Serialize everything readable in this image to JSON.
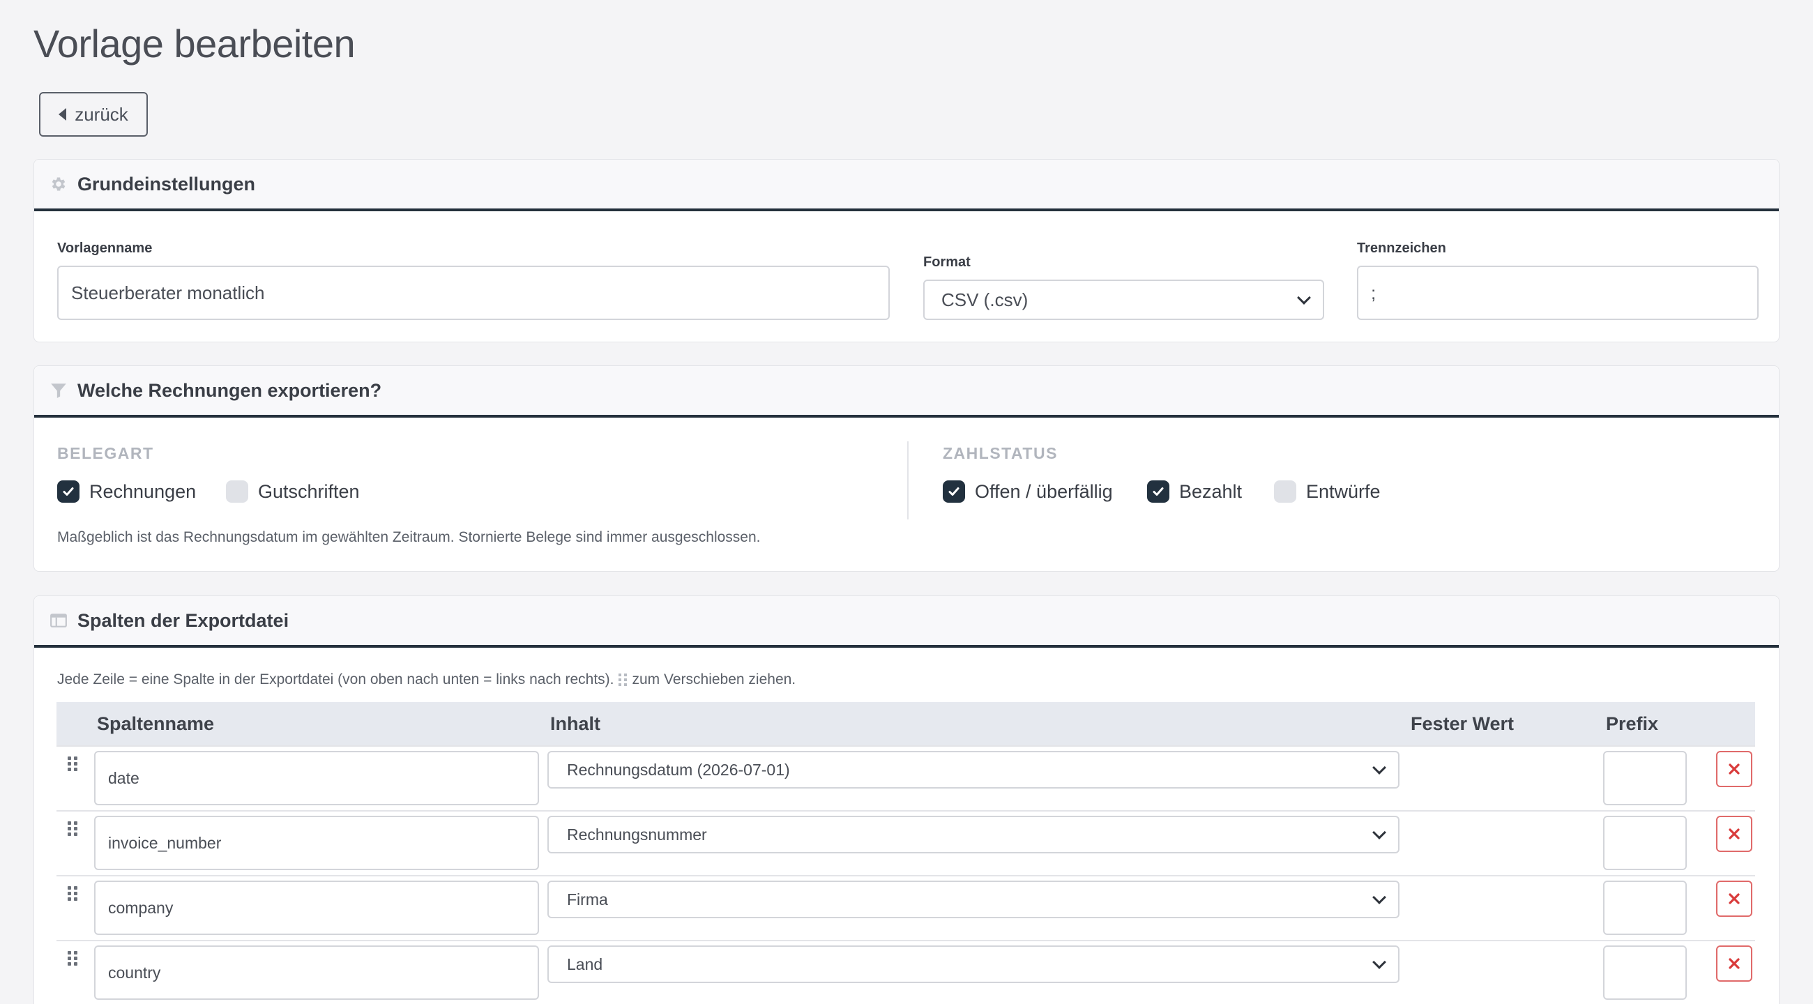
{
  "page": {
    "title": "Vorlage bearbeiten",
    "back_label": "zurück"
  },
  "basic": {
    "title": "Grundeinstellungen",
    "name_label": "Vorlagenname",
    "name_value": "Steuerberater monatlich",
    "format_label": "Format",
    "format_value": "CSV (.csv)",
    "sep_label": "Trennzeichen",
    "sep_value": ";"
  },
  "filter": {
    "title": "Welche Rechnungen exportieren?",
    "belegart_title": "BELEGART",
    "belegart": [
      {
        "label": "Rechnungen",
        "checked": true
      },
      {
        "label": "Gutschriften",
        "checked": false
      }
    ],
    "zahlstatus_title": "ZAHLSTATUS",
    "zahlstatus": [
      {
        "label": "Offen / überfällig",
        "checked": true
      },
      {
        "label": "Bezahlt",
        "checked": true
      },
      {
        "label": "Entwürfe",
        "checked": false
      }
    ],
    "help": "Maßgeblich ist das Rechnungsdatum im gewählten Zeitraum. Stornierte Belege sind immer ausgeschlossen."
  },
  "columns": {
    "title": "Spalten der Exportdatei",
    "help_before": "Jede Zeile = eine Spalte in der Exportdatei (von oben nach unten = links nach rechts).",
    "help_after": "zum Verschieben ziehen.",
    "headers": {
      "name": "Spaltenname",
      "content": "Inhalt",
      "fixed": "Fester Wert",
      "prefix": "Prefix"
    },
    "rows": [
      {
        "name": "date",
        "content": "Rechnungsdatum (2026-07-01)",
        "prefix": ""
      },
      {
        "name": "invoice_number",
        "content": "Rechnungsnummer",
        "prefix": ""
      },
      {
        "name": "company",
        "content": "Firma",
        "prefix": ""
      },
      {
        "name": "country",
        "content": "Land",
        "prefix": ""
      }
    ]
  },
  "icons": {
    "settings": "gear-icon",
    "filter": "funnel-icon",
    "columns": "table-columns-icon",
    "drag": "drag-handle-icon",
    "delete": "close-icon",
    "back": "caret-left-icon",
    "select": "chevron-down-icon",
    "check": "checkmark-icon"
  },
  "colors": {
    "header_rule": "#24303c",
    "checkbox_on": "#22313f",
    "delete": "#d93b3b",
    "table_header": "#e6e9ef"
  }
}
